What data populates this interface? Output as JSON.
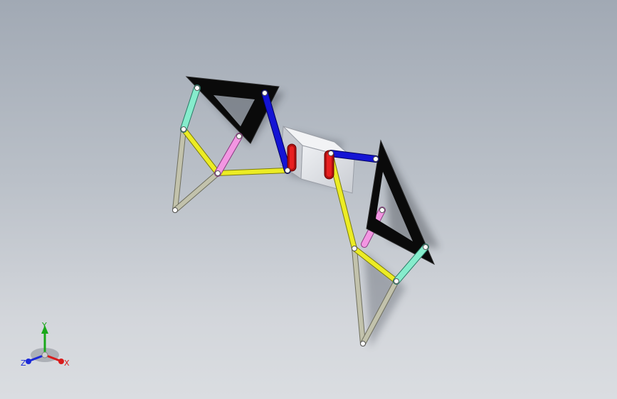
{
  "viewport": {
    "background_top": "#a1a9b4",
    "background_bottom": "#dadde1"
  },
  "triad": {
    "y_label": "Y",
    "x_label": "X",
    "z_label": "Z",
    "y_color": "#1aa81a",
    "x_color": "#d81c1c",
    "z_color": "#1c2ad8"
  },
  "colors": {
    "frame": "#0a0a0a",
    "crank": "#1010c8",
    "pin_block": "#d81818",
    "coupler": "#e8e818",
    "pink_link": "#ee88dd",
    "cyan_link": "#7ee8c8",
    "leg_link": "#b8b8a0",
    "body_block": "#e4e6ea"
  }
}
